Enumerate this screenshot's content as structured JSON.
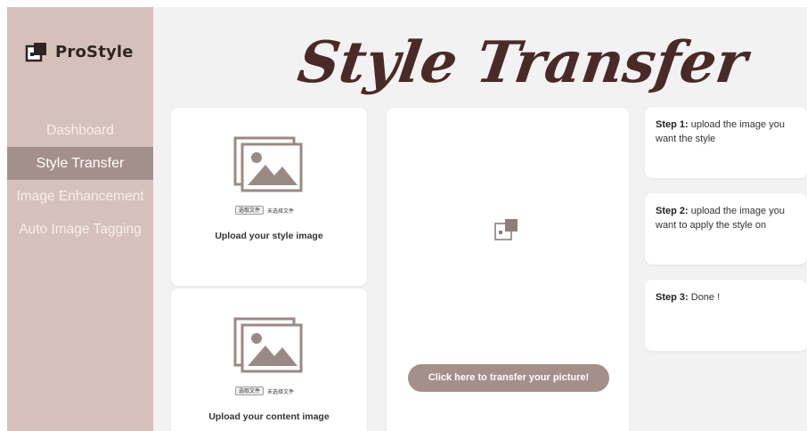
{
  "sidebar": {
    "brand": {
      "name": "ProStyle",
      "icon": "image-stack-icon"
    },
    "items": [
      {
        "label": "Dashboard",
        "active": false
      },
      {
        "label": "Style Transfer",
        "active": true
      },
      {
        "label": "Image Enhancement",
        "active": false
      },
      {
        "label": "Auto Image Tagging",
        "active": false
      }
    ]
  },
  "header": {
    "title": "Style Transfer"
  },
  "uploads": {
    "style": {
      "choose_button": "选取文件",
      "no_file_text": "未选择文件",
      "label": "Upload your style image",
      "icon": "image-placeholder-icon"
    },
    "content": {
      "choose_button": "选取文件",
      "no_file_text": "未选择文件",
      "label": "Upload your content image",
      "icon": "image-placeholder-icon"
    }
  },
  "result": {
    "icon": "broken-image-icon",
    "button_label": "Click here to transfer your picture!"
  },
  "steps": [
    {
      "title": "Step 1:",
      "text": "upload the image you want the style"
    },
    {
      "title": "Step 2:",
      "text": "upload the image you want to apply the style on"
    },
    {
      "title": "Step 3:",
      "text": "Done !"
    }
  ],
  "colors": {
    "sidebar_bg": "#d6c1ba",
    "sidebar_active": "#a4908a",
    "accent_button": "#a58f89",
    "title_brown": "#4a2a27"
  }
}
